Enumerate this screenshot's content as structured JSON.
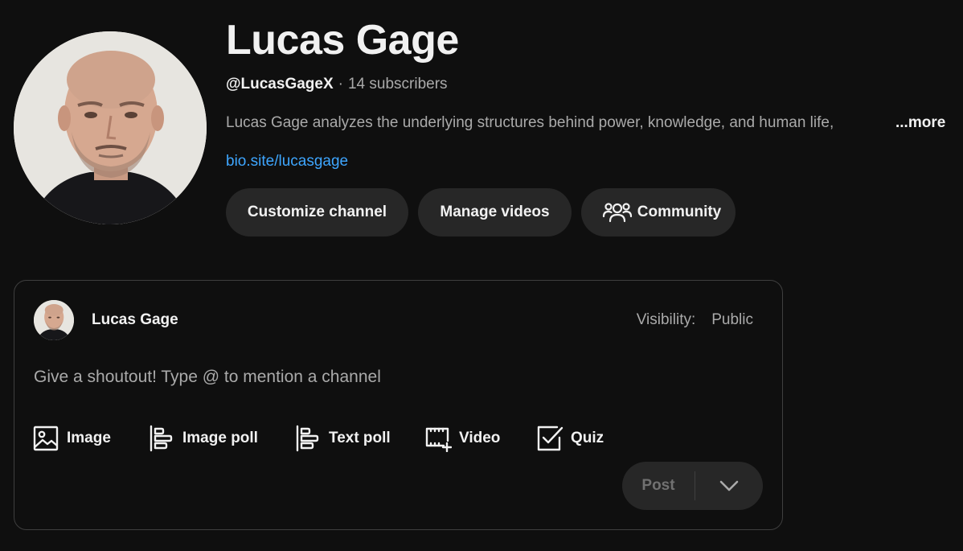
{
  "channel": {
    "name": "Lucas Gage",
    "handle": "@LucasGageX",
    "separator": "·",
    "subscribers": "14 subscribers",
    "description": "Lucas Gage analyzes the underlying structures behind power, knowledge, and human life,",
    "more_label": "...more",
    "link": "bio.site/lucasgage"
  },
  "actions": {
    "customize_label": "Customize channel",
    "manage_label": "Manage videos",
    "community_label": "Community",
    "community_icon": "people-icon"
  },
  "composer": {
    "author": "Lucas Gage",
    "visibility_label": "Visibility:",
    "visibility_value": "Public",
    "placeholder": "Give a shoutout! Type @ to mention a channel",
    "attachments": [
      {
        "label": "Image",
        "icon": "image-icon"
      },
      {
        "label": "Image poll",
        "icon": "image-poll-icon"
      },
      {
        "label": "Text poll",
        "icon": "text-poll-icon"
      },
      {
        "label": "Video",
        "icon": "video-add-icon"
      },
      {
        "label": "Quiz",
        "icon": "quiz-checkbox-icon"
      }
    ],
    "post_label": "Post",
    "dropdown_icon": "chevron-down-icon"
  },
  "colors": {
    "background": "#0f0f0f",
    "surface": "#272727",
    "border": "#3f3f3f",
    "text_primary": "#f1f1f1",
    "text_secondary": "#aaaaaa",
    "link": "#3ea6ff",
    "disabled": "#717171"
  }
}
